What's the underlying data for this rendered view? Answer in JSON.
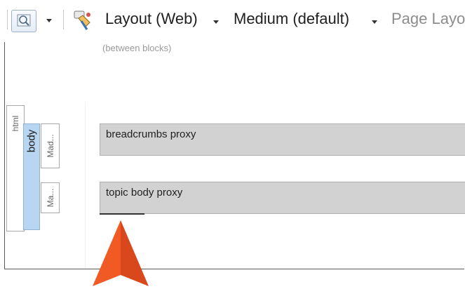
{
  "toolbar": {
    "layout_label": "Layout (Web)",
    "medium_label": "Medium (default)",
    "page_layout_label": "Page Layo"
  },
  "hint": "(between blocks)",
  "structure_tabs": {
    "html": "html",
    "body": "body",
    "mad": "Mad...",
    "ma": "Ma..."
  },
  "proxies": [
    {
      "label": "breadcrumbs proxy"
    },
    {
      "label": "topic body proxy"
    }
  ],
  "colors": {
    "body_tab": "#b8d6f2",
    "proxy_bg": "#d2d2d2",
    "arrow": "#f15a24"
  }
}
